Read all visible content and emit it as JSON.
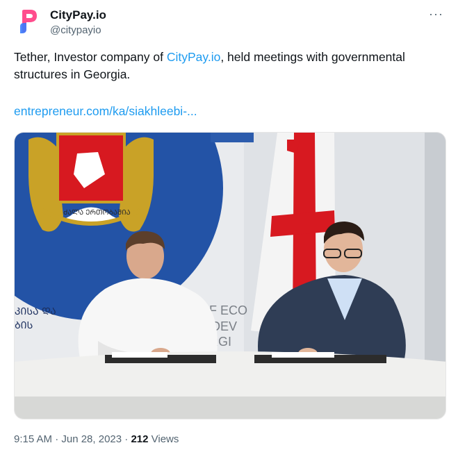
{
  "account": {
    "name": "CityPay.io",
    "handle": "@citypayio",
    "more_label": "···"
  },
  "tweet": {
    "text_before": "Tether, Investor company of ",
    "mention": "CityPay.io",
    "text_after": ", held meetings with governmental structures in Georgia.",
    "link": "entrepreneur.com/ka/siakhleebi-..."
  },
  "photo": {
    "wall_text_left": [
      "ᲙᲘᲡᲐ ᲓᲐ",
      "ᲑᲘᲡ"
    ],
    "wall_text_right": [
      "OF ECO",
      "E DEV",
      "ORGI"
    ],
    "emblem_ribbon": "ᲫᲐᲚᲐ ᲔᲠᲗᲝᲑᲐᲨᲘᲐ"
  },
  "meta": {
    "time": "9:15 AM · Jun 28, 2023 · ",
    "views_count": "212",
    "views_label": " Views"
  },
  "colors": {
    "link": "#1d9bf0",
    "logo_pink": "#ff4d8d",
    "logo_blue": "#3a7bfd",
    "flag_red": "#d71920",
    "emblem_blue": "#2353a6"
  }
}
